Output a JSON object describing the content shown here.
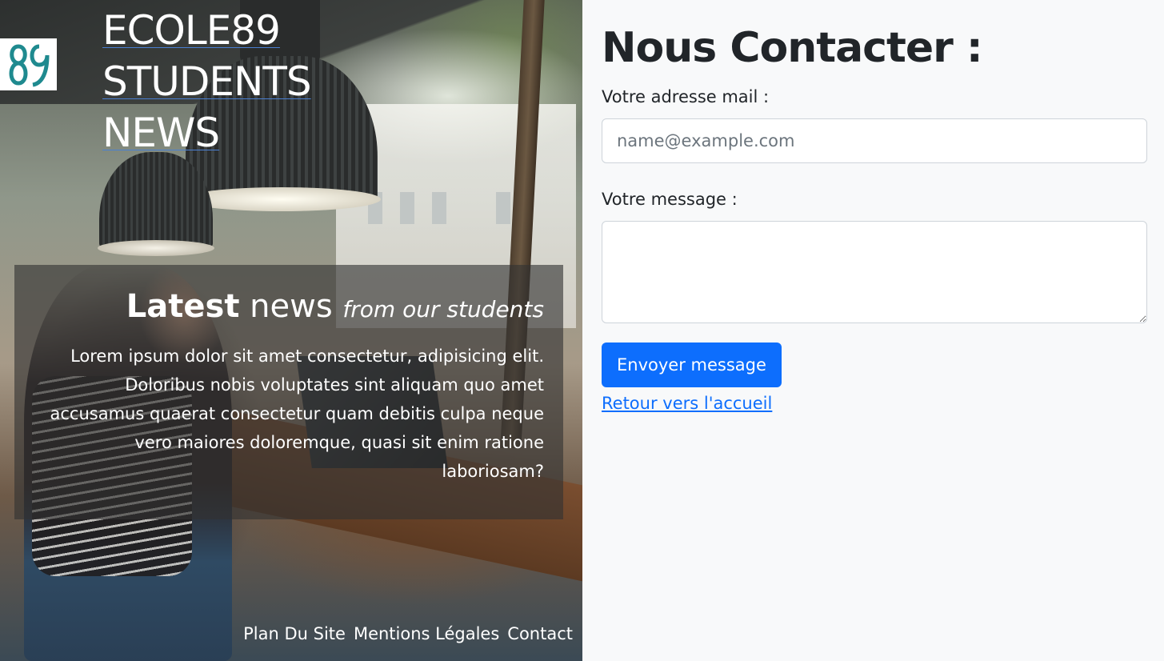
{
  "brand": {
    "logo_icon": "ecole89-logo-icon",
    "title_lines": [
      "ECOLE89",
      "STUDENTS",
      "NEWS"
    ]
  },
  "news": {
    "heading_strong": "Latest",
    "heading_light": "news",
    "heading_italic": "from our students",
    "body": "Lorem ipsum dolor sit amet consectetur, adipisicing elit. Doloribus nobis voluptates sint aliquam quo amet accusamus quaerat consectetur quam debitis culpa neque vero maiores doloremque, quasi sit enim ratione laboriosam?"
  },
  "footer": {
    "links": [
      "Plan Du Site",
      "Mentions Légales",
      "Contact"
    ]
  },
  "contact": {
    "title": "Nous Contacter :",
    "email_label": "Votre adresse mail :",
    "email_placeholder": "name@example.com",
    "email_value": "",
    "message_label": "Votre message :",
    "message_value": "",
    "submit_label": "Envoyer message",
    "back_link": "Retour vers l'accueil"
  },
  "colors": {
    "primary": "#0d6efd",
    "page_bg": "#f8f9fa",
    "heading": "#212529",
    "logo_teal": "#1f8a8f"
  }
}
